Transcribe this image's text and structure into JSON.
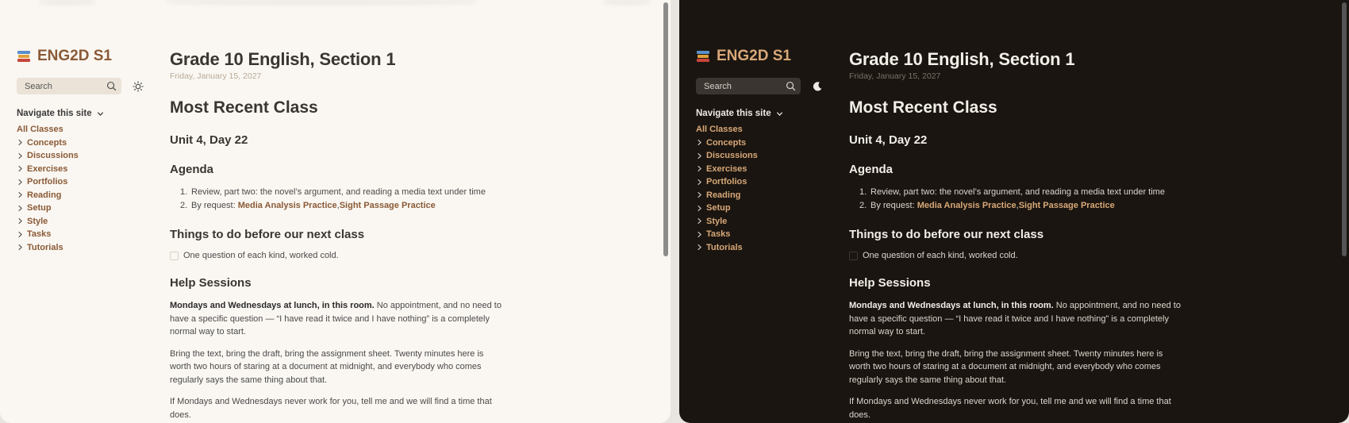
{
  "site": {
    "title": "ENG2D S1",
    "search_placeholder": "Search",
    "nav_title": "Navigate this site",
    "nav_items": [
      "All Classes",
      "Concepts",
      "Discussions",
      "Exercises",
      "Portfolios",
      "Reading",
      "Setup",
      "Style",
      "Tasks",
      "Tutorials"
    ]
  },
  "page": {
    "title": "Grade 10 English, Section 1",
    "date": "Friday, January 15, 2027",
    "h_recent": "Most Recent Class",
    "h_unit": "Unit 4, Day 22",
    "h_agenda": "Agenda",
    "agenda": [
      {
        "num": "1.",
        "text": "Review, part two: the novel’s argument, and reading a media text under time"
      },
      {
        "num": "2.",
        "text": "By request: ",
        "link1": "Media Analysis Practice",
        "sep": ", ",
        "link2": "Sight Passage Practice"
      }
    ],
    "h_todo": "Things to do before our next class",
    "todo_item": "One question of each kind, worked cold.",
    "h_help": "Help Sessions",
    "help_bold": "Mondays and Wednesdays at lunch, in this room.",
    "help_rest": " No appointment, and no need to have a specific question — “I have read it twice and I have nothing” is a completely normal way to start.",
    "help_p2": "Bring the text, bring the draft, bring the assignment sheet. Twenty minutes here is worth two hours of staring at a document at midnight, and everybody who comes regularly says the same thing about that.",
    "help_p3": "If Mondays and Wednesdays never work for you, tell me and we will find a time that does."
  },
  "colors": {
    "light_bg": "#faf7f2",
    "dark_bg": "#1a1510",
    "light_accent": "#8a5a36",
    "dark_accent": "#d8a878"
  },
  "icons": {
    "logo": "books-icon",
    "search": "search-icon",
    "light_theme": "sun-icon",
    "dark_theme": "moon-icon",
    "expand": "chevron-right-icon",
    "nav_toggle": "chevron-down-icon"
  }
}
